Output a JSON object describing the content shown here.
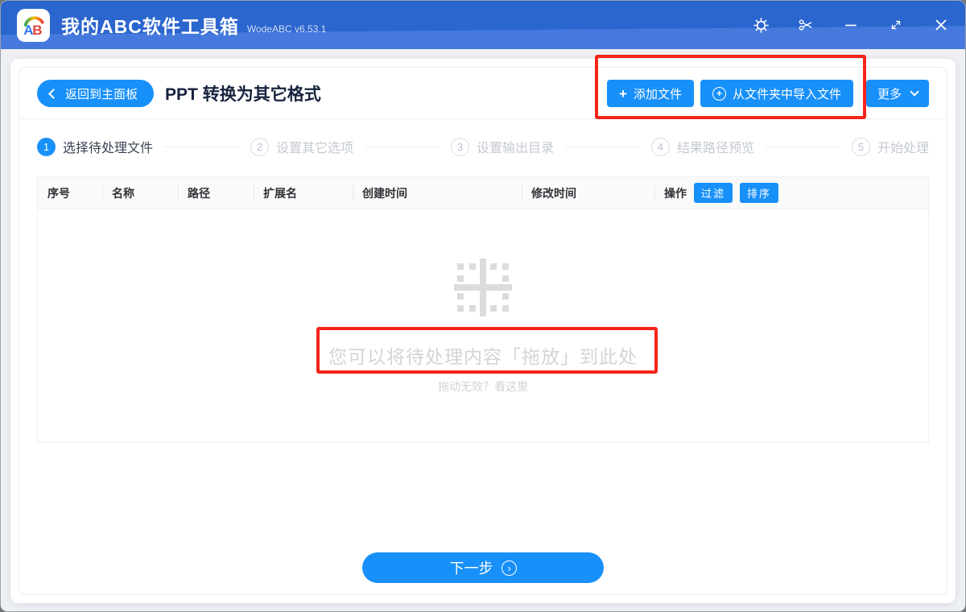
{
  "titlebar": {
    "app_title": "我的ABC软件工具箱",
    "version": "WodeABC v6.53.1",
    "logo": {
      "letter_a": "A",
      "letter_b": "B"
    }
  },
  "header": {
    "back_label": "返回到主面板",
    "page_title": "PPT 转换为其它格式",
    "add_files_label": "添加文件",
    "import_folder_label": "从文件夹中导入文件",
    "more_label": "更多"
  },
  "steps": [
    {
      "num": "1",
      "label": "选择待处理文件",
      "active": true
    },
    {
      "num": "2",
      "label": "设置其它选项",
      "active": false
    },
    {
      "num": "3",
      "label": "设置输出目录",
      "active": false
    },
    {
      "num": "4",
      "label": "结果路径预览",
      "active": false
    },
    {
      "num": "5",
      "label": "开始处理",
      "active": false
    }
  ],
  "table": {
    "columns": [
      "序号",
      "名称",
      "路径",
      "扩展名",
      "创建时间",
      "修改时间",
      "操作"
    ],
    "filter_label": "过滤",
    "sort_label": "排序",
    "rows": []
  },
  "dropzone": {
    "hint": "您可以将待处理内容「拖放」到此处",
    "sub_hint": "拖动无效？看这里"
  },
  "footer": {
    "next_label": "下一步"
  },
  "icons": {
    "plus": "+",
    "circle_plus": "+",
    "next_arrow": "›"
  },
  "colors": {
    "primary": "#1890fa",
    "titlebar_top": "#2b66cf",
    "titlebar_bottom": "#4679dd",
    "annotation": "#f5241a"
  }
}
